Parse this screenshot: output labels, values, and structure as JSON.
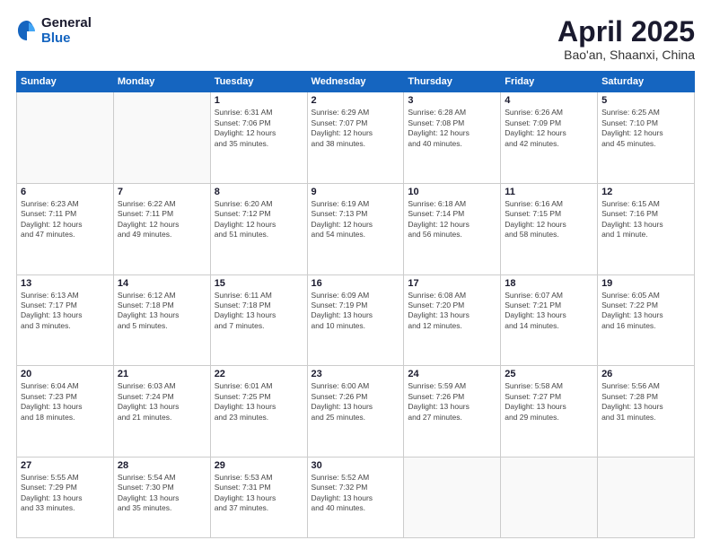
{
  "logo": {
    "general": "General",
    "blue": "Blue"
  },
  "title": "April 2025",
  "subtitle": "Bao'an, Shaanxi, China",
  "weekdays": [
    "Sunday",
    "Monday",
    "Tuesday",
    "Wednesday",
    "Thursday",
    "Friday",
    "Saturday"
  ],
  "weeks": [
    [
      {
        "day": "",
        "info": ""
      },
      {
        "day": "",
        "info": ""
      },
      {
        "day": "1",
        "info": "Sunrise: 6:31 AM\nSunset: 7:06 PM\nDaylight: 12 hours\nand 35 minutes."
      },
      {
        "day": "2",
        "info": "Sunrise: 6:29 AM\nSunset: 7:07 PM\nDaylight: 12 hours\nand 38 minutes."
      },
      {
        "day": "3",
        "info": "Sunrise: 6:28 AM\nSunset: 7:08 PM\nDaylight: 12 hours\nand 40 minutes."
      },
      {
        "day": "4",
        "info": "Sunrise: 6:26 AM\nSunset: 7:09 PM\nDaylight: 12 hours\nand 42 minutes."
      },
      {
        "day": "5",
        "info": "Sunrise: 6:25 AM\nSunset: 7:10 PM\nDaylight: 12 hours\nand 45 minutes."
      }
    ],
    [
      {
        "day": "6",
        "info": "Sunrise: 6:23 AM\nSunset: 7:11 PM\nDaylight: 12 hours\nand 47 minutes."
      },
      {
        "day": "7",
        "info": "Sunrise: 6:22 AM\nSunset: 7:11 PM\nDaylight: 12 hours\nand 49 minutes."
      },
      {
        "day": "8",
        "info": "Sunrise: 6:20 AM\nSunset: 7:12 PM\nDaylight: 12 hours\nand 51 minutes."
      },
      {
        "day": "9",
        "info": "Sunrise: 6:19 AM\nSunset: 7:13 PM\nDaylight: 12 hours\nand 54 minutes."
      },
      {
        "day": "10",
        "info": "Sunrise: 6:18 AM\nSunset: 7:14 PM\nDaylight: 12 hours\nand 56 minutes."
      },
      {
        "day": "11",
        "info": "Sunrise: 6:16 AM\nSunset: 7:15 PM\nDaylight: 12 hours\nand 58 minutes."
      },
      {
        "day": "12",
        "info": "Sunrise: 6:15 AM\nSunset: 7:16 PM\nDaylight: 13 hours\nand 1 minute."
      }
    ],
    [
      {
        "day": "13",
        "info": "Sunrise: 6:13 AM\nSunset: 7:17 PM\nDaylight: 13 hours\nand 3 minutes."
      },
      {
        "day": "14",
        "info": "Sunrise: 6:12 AM\nSunset: 7:18 PM\nDaylight: 13 hours\nand 5 minutes."
      },
      {
        "day": "15",
        "info": "Sunrise: 6:11 AM\nSunset: 7:18 PM\nDaylight: 13 hours\nand 7 minutes."
      },
      {
        "day": "16",
        "info": "Sunrise: 6:09 AM\nSunset: 7:19 PM\nDaylight: 13 hours\nand 10 minutes."
      },
      {
        "day": "17",
        "info": "Sunrise: 6:08 AM\nSunset: 7:20 PM\nDaylight: 13 hours\nand 12 minutes."
      },
      {
        "day": "18",
        "info": "Sunrise: 6:07 AM\nSunset: 7:21 PM\nDaylight: 13 hours\nand 14 minutes."
      },
      {
        "day": "19",
        "info": "Sunrise: 6:05 AM\nSunset: 7:22 PM\nDaylight: 13 hours\nand 16 minutes."
      }
    ],
    [
      {
        "day": "20",
        "info": "Sunrise: 6:04 AM\nSunset: 7:23 PM\nDaylight: 13 hours\nand 18 minutes."
      },
      {
        "day": "21",
        "info": "Sunrise: 6:03 AM\nSunset: 7:24 PM\nDaylight: 13 hours\nand 21 minutes."
      },
      {
        "day": "22",
        "info": "Sunrise: 6:01 AM\nSunset: 7:25 PM\nDaylight: 13 hours\nand 23 minutes."
      },
      {
        "day": "23",
        "info": "Sunrise: 6:00 AM\nSunset: 7:26 PM\nDaylight: 13 hours\nand 25 minutes."
      },
      {
        "day": "24",
        "info": "Sunrise: 5:59 AM\nSunset: 7:26 PM\nDaylight: 13 hours\nand 27 minutes."
      },
      {
        "day": "25",
        "info": "Sunrise: 5:58 AM\nSunset: 7:27 PM\nDaylight: 13 hours\nand 29 minutes."
      },
      {
        "day": "26",
        "info": "Sunrise: 5:56 AM\nSunset: 7:28 PM\nDaylight: 13 hours\nand 31 minutes."
      }
    ],
    [
      {
        "day": "27",
        "info": "Sunrise: 5:55 AM\nSunset: 7:29 PM\nDaylight: 13 hours\nand 33 minutes."
      },
      {
        "day": "28",
        "info": "Sunrise: 5:54 AM\nSunset: 7:30 PM\nDaylight: 13 hours\nand 35 minutes."
      },
      {
        "day": "29",
        "info": "Sunrise: 5:53 AM\nSunset: 7:31 PM\nDaylight: 13 hours\nand 37 minutes."
      },
      {
        "day": "30",
        "info": "Sunrise: 5:52 AM\nSunset: 7:32 PM\nDaylight: 13 hours\nand 40 minutes."
      },
      {
        "day": "",
        "info": ""
      },
      {
        "day": "",
        "info": ""
      },
      {
        "day": "",
        "info": ""
      }
    ]
  ]
}
